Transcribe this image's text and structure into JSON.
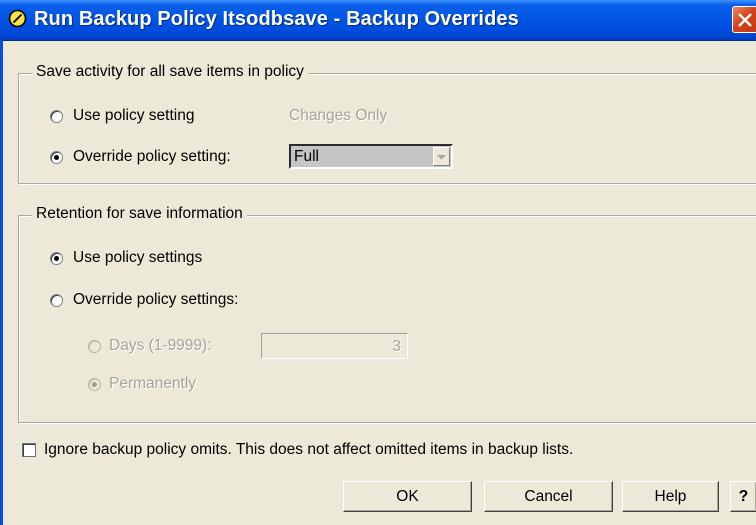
{
  "window": {
    "title": "Run Backup Policy Itsodbsave - Backup Overrides",
    "icon": "clock-icon",
    "colors": {
      "titlebar": "#0055e5",
      "close": "#d4431b",
      "face": "#ece9d8"
    }
  },
  "save_activity": {
    "legend": "Save activity for all save items in policy",
    "use_policy_label": "Use policy setting",
    "policy_value": "Changes Only",
    "override_label": "Override policy setting:",
    "override_selected": true,
    "override_value": "Full"
  },
  "retention": {
    "legend": "Retention for save information",
    "use_policy_label": "Use policy settings",
    "use_policy_selected": true,
    "override_label": "Override policy settings:",
    "days_label": "Days (1-9999):",
    "days_value": "3",
    "permanently_label": "Permanently",
    "permanently_selected": true
  },
  "ignore_omits": {
    "label": "Ignore backup policy omits.  This does not affect omitted items in backup lists.",
    "checked": false
  },
  "buttons": {
    "ok": "OK",
    "cancel": "Cancel",
    "help": "Help",
    "whats_this": "?"
  }
}
